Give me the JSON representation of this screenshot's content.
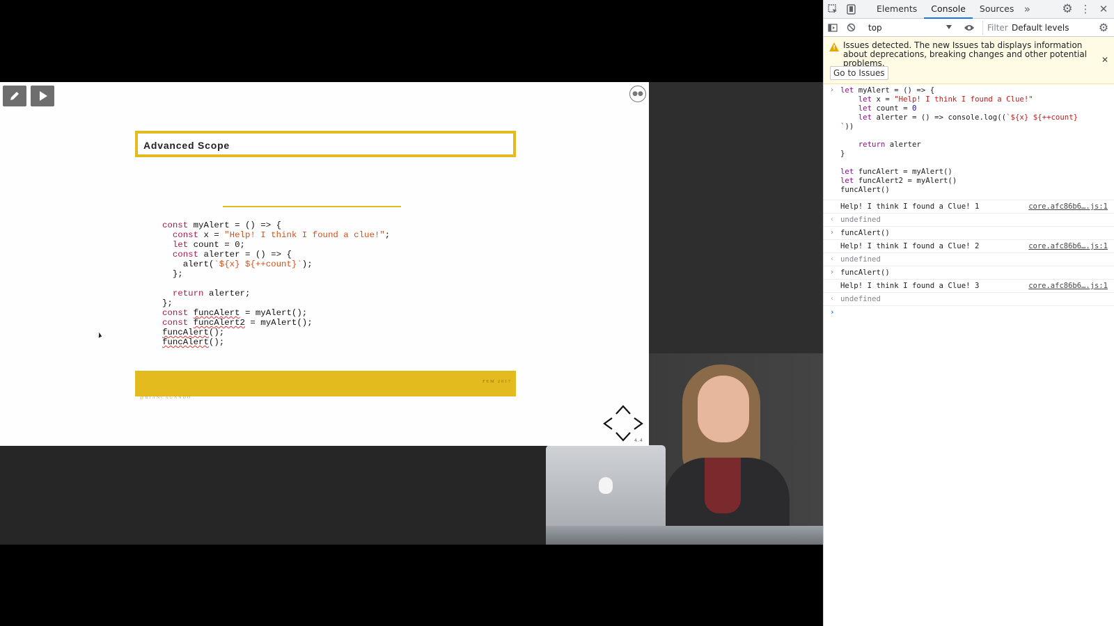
{
  "slide": {
    "title": "Advanced Scope",
    "code_lines": [
      [
        [
          "k",
          "const"
        ],
        [
          "t",
          " myAlert = () => {"
        ]
      ],
      [
        [
          "t",
          "  "
        ],
        [
          "k",
          "const"
        ],
        [
          "t",
          " x = "
        ],
        [
          "s",
          "\"Help! I think I found a clue!\""
        ],
        [
          "t",
          ";"
        ]
      ],
      [
        [
          "t",
          "  "
        ],
        [
          "k",
          "let"
        ],
        [
          "t",
          " count = 0;"
        ]
      ],
      [
        [
          "t",
          "  "
        ],
        [
          "k",
          "const"
        ],
        [
          "t",
          " alerter = () => {"
        ]
      ],
      [
        [
          "t",
          "    alert("
        ],
        [
          "s",
          "`${x} ${++count}`"
        ],
        [
          "t",
          ");"
        ]
      ],
      [
        [
          "t",
          "  };"
        ]
      ],
      [
        [
          "t",
          ""
        ]
      ],
      [
        [
          "t",
          "  "
        ],
        [
          "k",
          "return"
        ],
        [
          "t",
          " alerter;"
        ]
      ],
      [
        [
          "t",
          "};"
        ]
      ],
      [
        [
          "k",
          "const"
        ],
        [
          "t",
          " "
        ],
        [
          "u",
          "funcAlert"
        ],
        [
          "t",
          " = myAlert();"
        ]
      ],
      [
        [
          "k",
          "const"
        ],
        [
          "t",
          " "
        ],
        [
          "u",
          "funcAlert2"
        ],
        [
          "t",
          " = myAlert();"
        ]
      ],
      [
        [
          "u",
          "funcAlert"
        ],
        [
          "t",
          "();"
        ]
      ],
      [
        [
          "u",
          "funcAlert"
        ],
        [
          "t",
          "();"
        ]
      ]
    ],
    "footer_right": "FEM 2017",
    "footer_left": "@BIANCAGANDO",
    "slide_number": "4.4",
    "accent_color": "#e4bb1f"
  },
  "devtools": {
    "tabs": [
      "Elements",
      "Console",
      "Sources"
    ],
    "active_tab": "Console",
    "context": "top",
    "filter_placeholder": "Filter",
    "levels_label": "Default levels",
    "issues_message": "Issues detected. The new Issues tab displays information about deprecations, breaking changes and other potential problems.",
    "go_to_issues": "Go to Issues",
    "input_block": "let myAlert = () => {\n    let x = \"Help! I think I found a Clue!\"\n    let count = 0\n    let alerter = () => console.log((`${x} ${++count}\n`))\n\n    return alerter\n}\n\nlet funcAlert = myAlert()\nlet funcAlert2 = myAlert()\nfuncAlert()",
    "log1": "Help! I think I found a Clue! 1",
    "log2": "Help! I think I found a Clue! 2",
    "log3": "Help! I think I found a Clue! 3",
    "source_link": "core.afc86b6….js:1",
    "undefined_text": "undefined",
    "call_text": "funcAlert()"
  }
}
